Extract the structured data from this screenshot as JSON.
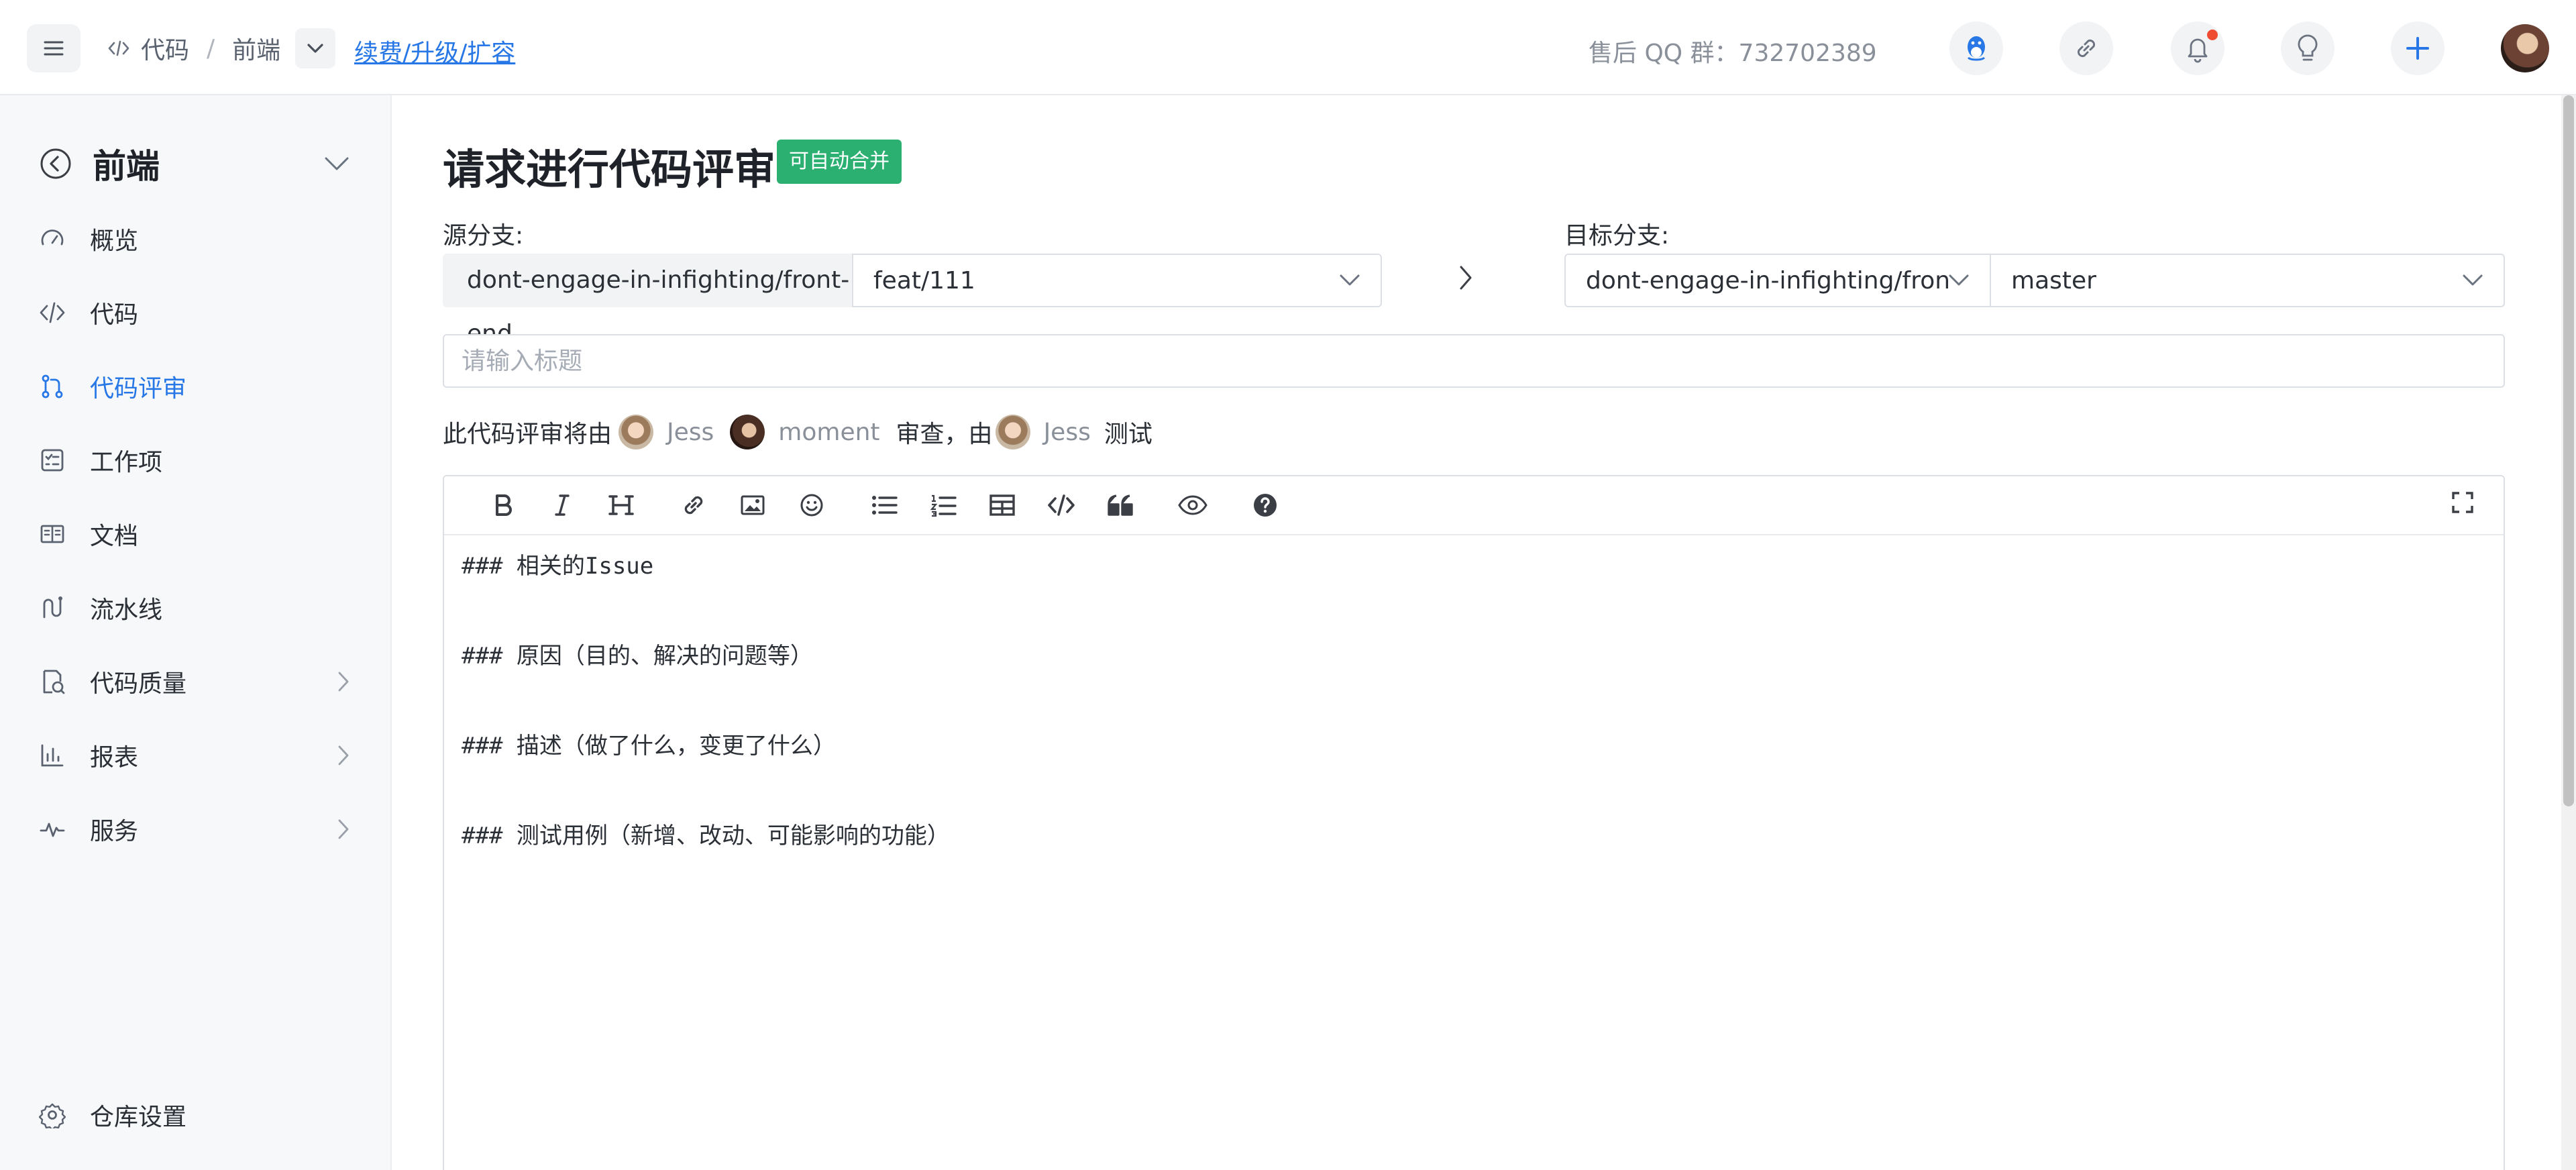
{
  "topbar": {
    "breadcrumb": [
      "代码",
      "前端"
    ],
    "renew_link": "续费/升级/扩容",
    "qq_group": "售后 QQ 群：732702389"
  },
  "sidebar": {
    "repo_name": "前端",
    "items": [
      {
        "label": "概览",
        "icon": "gauge-icon"
      },
      {
        "label": "代码",
        "icon": "code-icon"
      },
      {
        "label": "代码评审",
        "icon": "merge-request-icon",
        "active": true
      },
      {
        "label": "工作项",
        "icon": "checklist-icon"
      },
      {
        "label": "文档",
        "icon": "book-icon"
      },
      {
        "label": "流水线",
        "icon": "pipeline-icon"
      },
      {
        "label": "代码质量",
        "icon": "quality-icon",
        "expandable": true
      },
      {
        "label": "报表",
        "icon": "bar-chart-icon",
        "expandable": true
      },
      {
        "label": "服务",
        "icon": "pulse-icon",
        "expandable": true
      }
    ],
    "settings": "仓库设置"
  },
  "main": {
    "title": "请求进行代码评审",
    "badge": "可自动合并",
    "source_label": "源分支:",
    "source_repo": "dont-engage-in-infighting/front-end",
    "source_branch": "feat/111",
    "target_label": "目标分支:",
    "target_repo": "dont-engage-in-infighting/front-end",
    "target_branch": "master",
    "title_placeholder": "请输入标题",
    "reviewers": {
      "prefix": "此代码评审将由",
      "reviewer1": "Jess",
      "reviewer2": "moment",
      "middle": "审查，由",
      "tester": "Jess",
      "suffix": "测试"
    },
    "editor_lines": [
      "### 相关的Issue",
      "### 原因（目的、解决的问题等）",
      "### 描述（做了什么，变更了什么）",
      "### 测试用例（新增、改动、可能影响的功能）"
    ]
  },
  "colors": {
    "accent": "#2877e6",
    "badge_green": "#2bb071",
    "notification_red": "#ef4b32"
  }
}
